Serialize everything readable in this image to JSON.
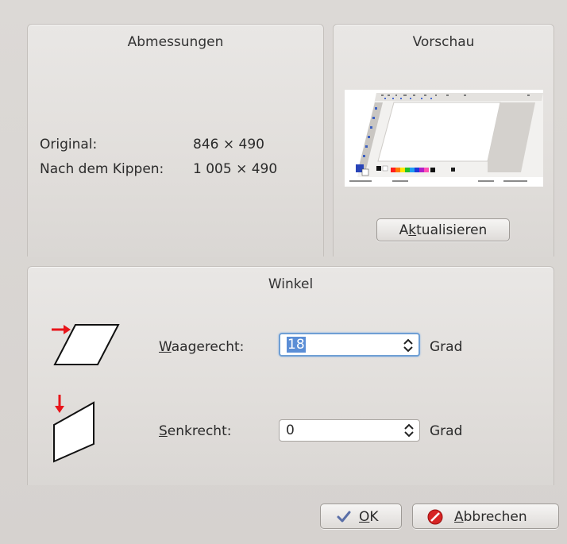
{
  "dimensions": {
    "title": "Abmessungen",
    "original_label": "Original:",
    "original_value": "846 × 490",
    "after_label": "Nach dem Kippen:",
    "after_value": "1 005 × 490"
  },
  "preview": {
    "title": "Vorschau",
    "update_button": {
      "prefix": "A",
      "mnemonic": "k",
      "suffix": "tualisieren"
    }
  },
  "angle": {
    "title": "Winkel",
    "horizontal": {
      "mnemonic": "W",
      "label_rest": "aagerecht:",
      "value": "18",
      "unit": "Grad"
    },
    "vertical": {
      "mnemonic": "S",
      "label_rest": "enkrecht:",
      "value": "0",
      "unit": "Grad"
    }
  },
  "buttons": {
    "ok": {
      "mnemonic": "O",
      "rest": "K"
    },
    "cancel": {
      "mnemonic": "A",
      "rest": "bbrechen"
    }
  },
  "colors": {
    "arrow_red": "#e8141a",
    "focus_blue": "#6f9fd4",
    "cancel_icon_red": "#d62424",
    "ok_check": "#5a6fa8"
  },
  "icons": [
    "skew-horizontal-icon",
    "skew-vertical-icon",
    "spin-arrows-icon",
    "checkmark-icon",
    "cancel-icon"
  ]
}
